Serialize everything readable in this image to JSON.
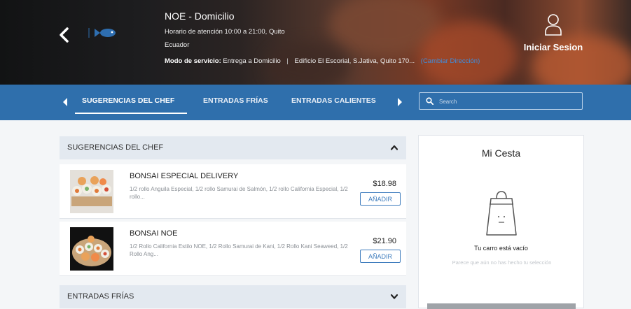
{
  "header": {
    "store_name": "NOE - Domicilio",
    "hours": "Horario de atención 10:00 a 21:00, Quito",
    "country": "Ecuador",
    "service_label": "Modo de servicio:",
    "service_mode": "Entrega a Domicilio",
    "separator": "|",
    "address": "Edificio El Escorial, S.Jativa, Quito 170...",
    "change_link": "(Cambiar Dirección)",
    "login_label": "Iniciar Sesion",
    "icons": {
      "back": "chevron-left-icon",
      "logo": "fish-logo",
      "user": "user-icon"
    }
  },
  "nav": {
    "tabs": [
      {
        "label": "SUGERENCIAS DEL CHEF",
        "active": true
      },
      {
        "label": "ENTRADAS FRÍAS",
        "active": false
      },
      {
        "label": "ENTRADAS CALIENTES",
        "active": false
      }
    ],
    "search_placeholder": "Search"
  },
  "menu": {
    "sections": [
      {
        "title": "SUGERENCIAS DEL CHEF",
        "expanded": true,
        "products": [
          {
            "name": "BONSAI ESPECIAL DELIVERY",
            "description": "1/2 rollo Anguila Especial, 1/2 rollo Samurai de Salmón, 1/2 rollo California Especial, 1/2 rollo...",
            "price": "$18.98",
            "button": "AÑADIR"
          },
          {
            "name": "BONSAI NOE",
            "description": "1/2 Rollo California Estilo NOE, 1/2 Rollo Samurai de Kani, 1/2 Rollo Kani Seaweed, 1/2 Rollo Ang...",
            "price": "$21.90",
            "button": "AÑADIR"
          }
        ]
      },
      {
        "title": "ENTRADAS FRÍAS",
        "expanded": false,
        "products": []
      }
    ]
  },
  "cart": {
    "title": "Mi Cesta",
    "empty_message": "Tu carro está vacío",
    "hint": "Parece que aún no has hecho tu selección"
  },
  "colors": {
    "nav_blue": "#2f6fac",
    "accent_blue": "#3e7cbd",
    "section_bg": "#e3e9f0"
  }
}
